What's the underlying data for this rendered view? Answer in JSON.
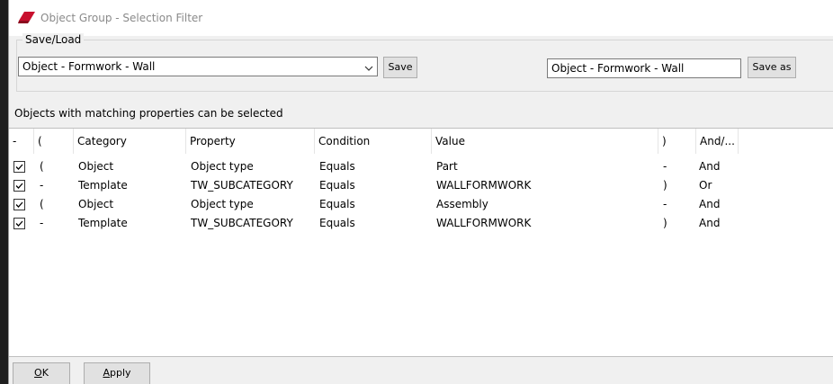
{
  "window": {
    "title": "Object Group - Selection Filter"
  },
  "saveload": {
    "legend": "Save/Load",
    "selected_filter": "Object - Formwork - Wall",
    "save_label": "Save",
    "save_name_value": "Object - Formwork - Wall",
    "save_as_label": "Save as"
  },
  "hint": "Objects with matching properties can be selected",
  "table": {
    "columns": [
      "-",
      "(",
      "Category",
      "Property",
      "Condition",
      "Value",
      ")",
      "And/..."
    ],
    "rows": [
      {
        "checked": true,
        "open": "(",
        "category": "Object",
        "property": "Object type",
        "condition": "Equals",
        "value": "Part",
        "close": "-",
        "andor": "And"
      },
      {
        "checked": true,
        "open": "-",
        "category": "Template",
        "property": "TW_SUBCATEGORY",
        "condition": "Equals",
        "value": "WALLFORMWORK",
        "close": ")",
        "andor": "Or"
      },
      {
        "checked": true,
        "open": "(",
        "category": "Object",
        "property": "Object type",
        "condition": "Equals",
        "value": "Assembly",
        "close": "-",
        "andor": "And"
      },
      {
        "checked": true,
        "open": "-",
        "category": "Template",
        "property": "TW_SUBCATEGORY",
        "condition": "Equals",
        "value": "WALLFORMWORK",
        "close": ")",
        "andor": "And"
      }
    ]
  },
  "buttons": {
    "ok_mnemonic": "O",
    "ok_rest": "K",
    "apply_mnemonic": "A",
    "apply_rest": "pply"
  },
  "colors": {
    "accent": "#0078d7",
    "icon": "#c8102e",
    "title_text": "#8a8a8a"
  },
  "icons": {
    "app": "tekla-app-icon",
    "dropdown": "chevron-down-icon",
    "check": "checkmark-icon"
  }
}
